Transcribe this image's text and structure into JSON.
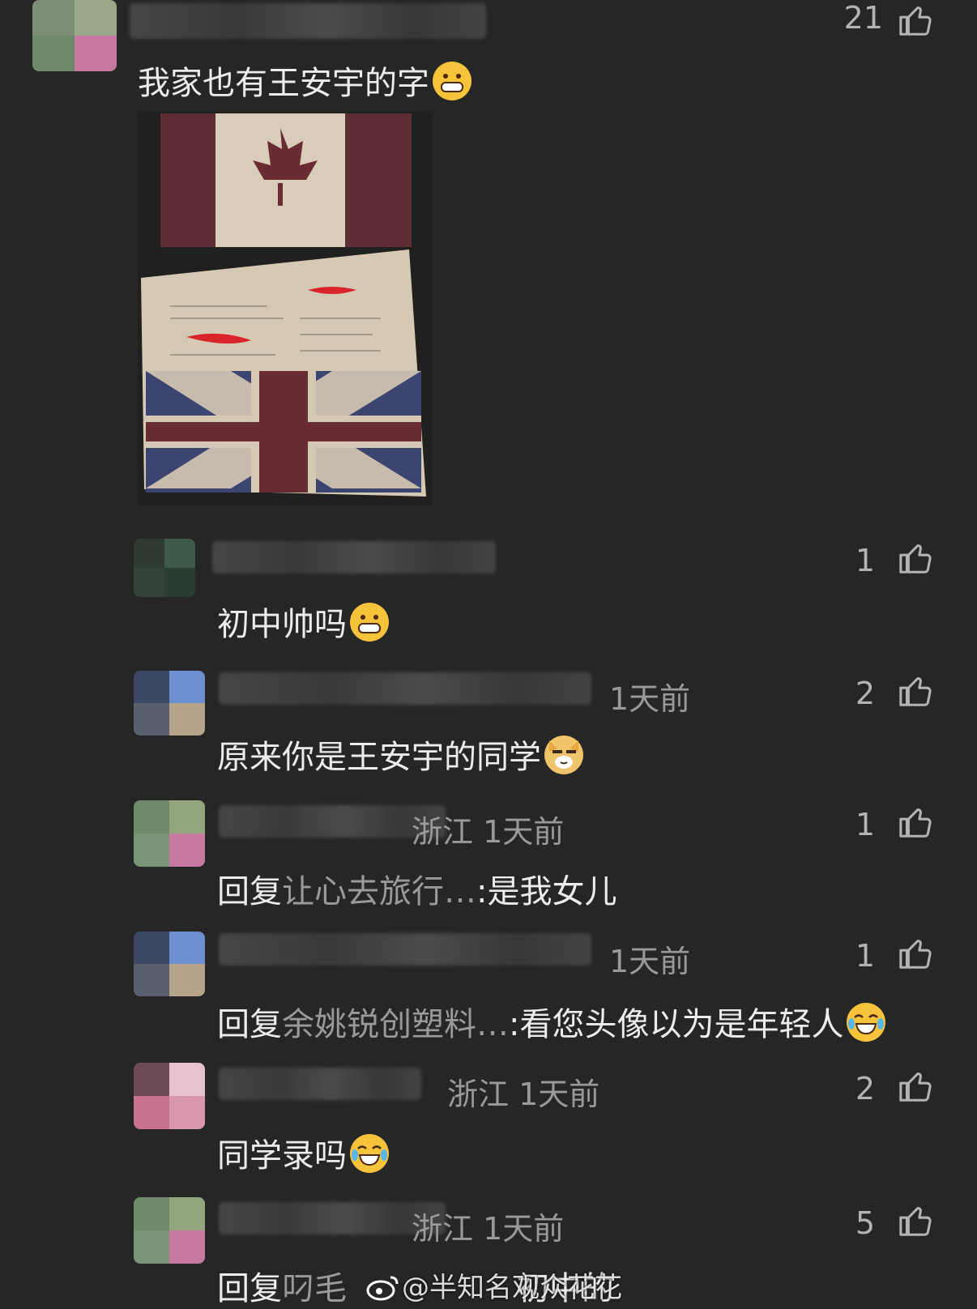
{
  "comments": [
    {
      "likes": "21",
      "text": "我家也有王安宇的字",
      "emoji": "grin-emoji"
    },
    {
      "likes": "1",
      "text": "初中帅吗",
      "emoji": "grin-emoji"
    },
    {
      "meta": "1天前",
      "likes": "2",
      "text": "原来你是王安宇的同学",
      "emoji": "dog-smirk-emoji"
    },
    {
      "meta": "浙江  1天前",
      "likes": "1",
      "reply_prefix": "回复",
      "reply_to": "让心去旅行…",
      "text": ":是我女儿"
    },
    {
      "meta": "1天前",
      "likes": "1",
      "reply_prefix": "回复",
      "reply_to": "余姚锐创塑料…",
      "text": ":看您头像以为是年轻人",
      "emoji": "laugh-cry-emoji"
    },
    {
      "meta": "浙江  1天前",
      "likes": "2",
      "text": "同学录吗",
      "emoji": "laugh-cry-emoji"
    },
    {
      "meta": "浙江  1天前",
      "likes": "5",
      "reply_prefix": "回复",
      "reply_to": "叼毛",
      "text": "初中的"
    }
  ],
  "watermark": "@半知名观众花花",
  "colors": {
    "bg": "#262626",
    "text": "#ececec",
    "muted": "#9a9a9a"
  }
}
